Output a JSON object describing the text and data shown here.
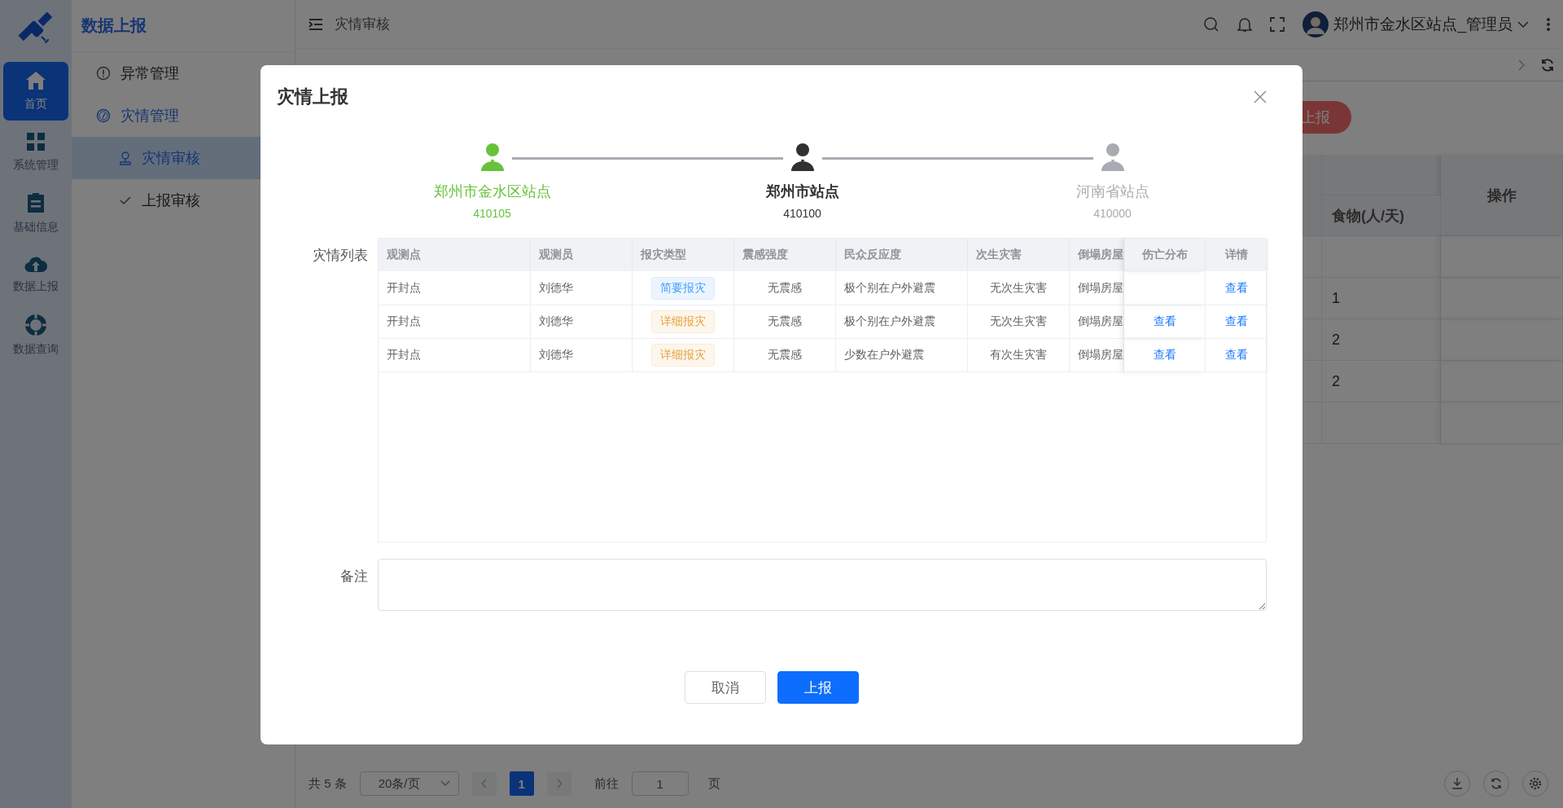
{
  "rail": [
    {
      "label": "首页",
      "selected": true
    },
    {
      "label": "系统管理",
      "selected": false
    },
    {
      "label": "基础信息",
      "selected": false
    },
    {
      "label": "数据上报",
      "selected": false
    },
    {
      "label": "数据查询",
      "selected": false
    }
  ],
  "submenu": {
    "title": "数据上报",
    "items": [
      {
        "label": "异常管理",
        "active": false
      },
      {
        "label": "灾情管理",
        "active": true,
        "children": [
          {
            "label": "灾情审核",
            "selected": true
          },
          {
            "label": "上报审核",
            "selected": false
          }
        ]
      }
    ]
  },
  "header": {
    "page_title": "灾情审核",
    "user_name": "郑州市金水区站点_管理员"
  },
  "page": {
    "action_button": "上报",
    "table": {
      "columns": [
        "食物(人/天)",
        "操作"
      ],
      "rows": [
        {},
        {
          "food": "1"
        },
        {
          "food": "2"
        },
        {
          "food": "2"
        },
        {}
      ]
    },
    "pagination": {
      "total": "共 5 条",
      "page_size": "20条/页",
      "pages": [
        {
          "label": "1",
          "selected": true
        }
      ],
      "goto_label": "前往",
      "goto_value": "1",
      "page_unit": "页"
    }
  },
  "dialog": {
    "title": "灾情上报",
    "steps": [
      {
        "name": "郑州市金水区站点",
        "code": "410105",
        "done": true,
        "active": false
      },
      {
        "name": "郑州市站点",
        "code": "410100",
        "done": false,
        "active": true
      },
      {
        "name": "河南省站点",
        "code": "410000",
        "done": false,
        "active": false
      }
    ],
    "list_label": "灾情列表",
    "columns": [
      "观测点",
      "观测员",
      "报灾类型",
      "震感强度",
      "民众反应度",
      "次生灾害",
      "倒塌房屋",
      "伤亡分布",
      "详情"
    ],
    "rows": [
      {
        "site": "开封点",
        "observer": "刘德华",
        "report_type": {
          "label": "简要报灾",
          "kind": "brief"
        },
        "intensity": "无震感",
        "reaction": "极个别在户外避震",
        "secondary": "无次生灾害",
        "collapse": "倒塌房屋",
        "detail_link": "查看"
      },
      {
        "site": "开封点",
        "observer": "刘德华",
        "report_type": {
          "label": "详细报灾",
          "kind": "detailed"
        },
        "intensity": "无震感",
        "reaction": "极个别在户外避震",
        "secondary": "无次生灾害",
        "collapse": "倒塌房屋",
        "casualty_link": "查看",
        "detail_link": "查看"
      },
      {
        "site": "开封点",
        "observer": "刘德华",
        "report_type": {
          "label": "详细报灾",
          "kind": "detailed"
        },
        "intensity": "无震感",
        "reaction": "少数在户外避震",
        "secondary": "有次生灾害",
        "collapse": "倒塌房屋",
        "casualty_link": "查看",
        "detail_link": "查看"
      }
    ],
    "remark_label": "备注",
    "buttons": [
      {
        "label": "取消",
        "kind": "secondary"
      },
      {
        "label": "上报",
        "kind": "primary"
      }
    ]
  }
}
